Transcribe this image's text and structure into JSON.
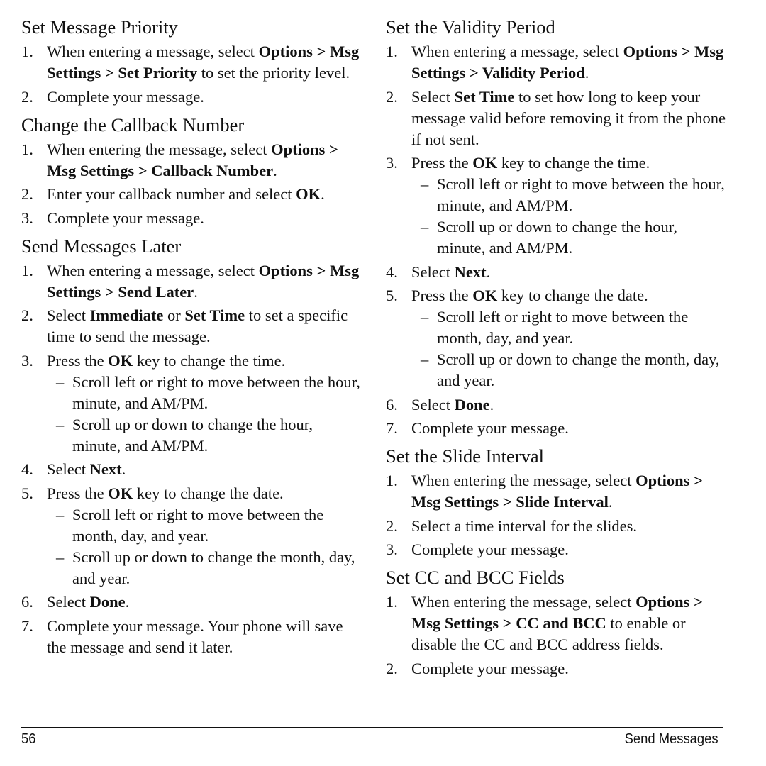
{
  "left_column": {
    "sections": [
      {
        "heading": "Set Message Priority",
        "steps": [
          {
            "num": "1.",
            "parts": [
              {
                "t": "When entering a message, select ",
                "b": false
              },
              {
                "t": "Options > Msg Settings > Set Priority",
                "b": true
              },
              {
                "t": " to set the priority level.",
                "b": false
              }
            ]
          },
          {
            "num": "2.",
            "parts": [
              {
                "t": "Complete your message.",
                "b": false
              }
            ]
          }
        ]
      },
      {
        "heading": "Change the Callback Number",
        "steps": [
          {
            "num": "1.",
            "parts": [
              {
                "t": "When entering the message, select ",
                "b": false
              },
              {
                "t": "Options > Msg Settings > Callback Number",
                "b": true
              },
              {
                "t": ".",
                "b": false
              }
            ]
          },
          {
            "num": "2.",
            "parts": [
              {
                "t": "Enter your callback number and select ",
                "b": false
              },
              {
                "t": "OK",
                "b": true
              },
              {
                "t": ".",
                "b": false
              }
            ]
          },
          {
            "num": "3.",
            "parts": [
              {
                "t": "Complete your message.",
                "b": false
              }
            ]
          }
        ]
      },
      {
        "heading": "Send Messages Later",
        "steps": [
          {
            "num": "1.",
            "parts": [
              {
                "t": "When entering a message, select ",
                "b": false
              },
              {
                "t": "Options > Msg Settings > Send Later",
                "b": true
              },
              {
                "t": ".",
                "b": false
              }
            ]
          },
          {
            "num": "2.",
            "parts": [
              {
                "t": "Select ",
                "b": false
              },
              {
                "t": "Immediate",
                "b": true
              },
              {
                "t": " or ",
                "b": false
              },
              {
                "t": "Set Time",
                "b": true
              },
              {
                "t": " to set a specific time to send the message.",
                "b": false
              }
            ]
          },
          {
            "num": "3.",
            "parts": [
              {
                "t": "Press the ",
                "b": false
              },
              {
                "t": "OK",
                "b": true
              },
              {
                "t": " key to change the time.",
                "b": false
              }
            ],
            "subs": [
              "Scroll left or right to move between the hour, minute, and AM/PM.",
              "Scroll up or down to change the hour, minute, and AM/PM."
            ]
          },
          {
            "num": "4.",
            "parts": [
              {
                "t": "Select ",
                "b": false
              },
              {
                "t": "Next",
                "b": true
              },
              {
                "t": ".",
                "b": false
              }
            ]
          },
          {
            "num": "5.",
            "parts": [
              {
                "t": "Press the ",
                "b": false
              },
              {
                "t": "OK",
                "b": true
              },
              {
                "t": " key to change the date.",
                "b": false
              }
            ],
            "subs": [
              "Scroll left or right to move between the month, day, and year.",
              "Scroll up or down to change the month, day, and year."
            ]
          },
          {
            "num": "6.",
            "parts": [
              {
                "t": "Select ",
                "b": false
              },
              {
                "t": "Done",
                "b": true
              },
              {
                "t": ".",
                "b": false
              }
            ]
          },
          {
            "num": "7.",
            "parts": [
              {
                "t": "Complete your message. Your phone will save the message and send it later.",
                "b": false
              }
            ]
          }
        ]
      }
    ]
  },
  "right_column": {
    "sections": [
      {
        "heading": "Set the Validity Period",
        "steps": [
          {
            "num": "1.",
            "parts": [
              {
                "t": "When entering a message, select ",
                "b": false
              },
              {
                "t": "Options > Msg Settings > Validity Period",
                "b": true
              },
              {
                "t": ".",
                "b": false
              }
            ]
          },
          {
            "num": "2.",
            "parts": [
              {
                "t": "Select ",
                "b": false
              },
              {
                "t": "Set Time",
                "b": true
              },
              {
                "t": " to set how long to keep your message valid before removing it from the phone if not sent.",
                "b": false
              }
            ]
          },
          {
            "num": "3.",
            "parts": [
              {
                "t": "Press the ",
                "b": false
              },
              {
                "t": "OK",
                "b": true
              },
              {
                "t": " key to change the time.",
                "b": false
              }
            ],
            "subs": [
              "Scroll left or right to move between the hour, minute, and AM/PM.",
              "Scroll up or down to change the hour, minute, and AM/PM."
            ]
          },
          {
            "num": "4.",
            "parts": [
              {
                "t": "Select ",
                "b": false
              },
              {
                "t": "Next",
                "b": true
              },
              {
                "t": ".",
                "b": false
              }
            ]
          },
          {
            "num": "5.",
            "parts": [
              {
                "t": "Press the ",
                "b": false
              },
              {
                "t": "OK",
                "b": true
              },
              {
                "t": " key to change the date.",
                "b": false
              }
            ],
            "subs": [
              "Scroll left or right to move between the month, day, and year.",
              "Scroll up or down to change the month, day, and year."
            ]
          },
          {
            "num": "6.",
            "parts": [
              {
                "t": "Select ",
                "b": false
              },
              {
                "t": "Done",
                "b": true
              },
              {
                "t": ".",
                "b": false
              }
            ]
          },
          {
            "num": "7.",
            "parts": [
              {
                "t": "Complete your message.",
                "b": false
              }
            ]
          }
        ]
      },
      {
        "heading": "Set the Slide Interval",
        "steps": [
          {
            "num": "1.",
            "parts": [
              {
                "t": "When entering the message, select ",
                "b": false
              },
              {
                "t": "Options > Msg Settings > Slide Interval",
                "b": true
              },
              {
                "t": ".",
                "b": false
              }
            ]
          },
          {
            "num": "2.",
            "parts": [
              {
                "t": "Select a time interval for the slides.",
                "b": false
              }
            ]
          },
          {
            "num": "3.",
            "parts": [
              {
                "t": "Complete your message.",
                "b": false
              }
            ]
          }
        ]
      },
      {
        "heading": "Set CC and BCC Fields",
        "steps": [
          {
            "num": "1.",
            "parts": [
              {
                "t": "When entering the message, select ",
                "b": false
              },
              {
                "t": "Options > Msg Settings > CC and BCC",
                "b": true
              },
              {
                "t": " to enable or disable the CC and BCC address fields.",
                "b": false
              }
            ]
          },
          {
            "num": "2.",
            "parts": [
              {
                "t": "Complete your message.",
                "b": false
              }
            ]
          }
        ]
      }
    ]
  },
  "footer": {
    "page_number": "56",
    "chapter": "Send Messages"
  },
  "icons": {
    "sub_bullet": "–"
  }
}
